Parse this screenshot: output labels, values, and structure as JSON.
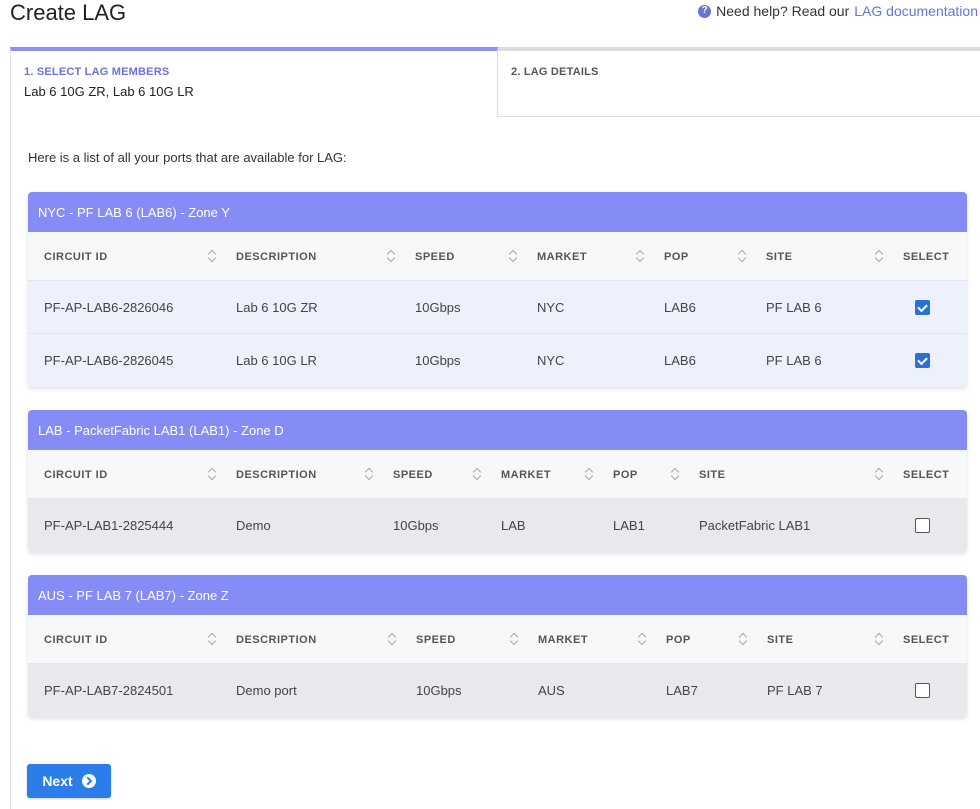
{
  "header": {
    "title": "Create LAG",
    "help_text": "Need help? Read our",
    "help_link": "LAG documentation",
    "help_icon": "question-circle-icon"
  },
  "steps": [
    {
      "label": "1. SELECT LAG MEMBERS",
      "value": "Lab 6 10G ZR, Lab 6 10G LR",
      "active": true
    },
    {
      "label": "2. LAG DETAILS",
      "value": "",
      "active": false
    }
  ],
  "intro": "Here is a list of all your ports that are available for LAG:",
  "groups": [
    {
      "title": "NYC - PF LAB 6 (LAB6) - Zone Y",
      "columns": [
        "CIRCUIT ID",
        "DESCRIPTION",
        "SPEED",
        "MARKET",
        "POP",
        "SITE",
        "SELECT"
      ],
      "rows": [
        {
          "circuit_id": "PF-AP-LAB6-2826046",
          "description": "Lab 6 10G ZR",
          "speed": "10Gbps",
          "market": "NYC",
          "pop": "LAB6",
          "site": "PF LAB 6",
          "selected": true
        },
        {
          "circuit_id": "PF-AP-LAB6-2826045",
          "description": "Lab 6 10G LR",
          "speed": "10Gbps",
          "market": "NYC",
          "pop": "LAB6",
          "site": "PF LAB 6",
          "selected": true
        }
      ]
    },
    {
      "title": "LAB - PacketFabric LAB1 (LAB1) - Zone D",
      "columns": [
        "CIRCUIT ID",
        "DESCRIPTION",
        "SPEED",
        "MARKET",
        "POP",
        "SITE",
        "SELECT"
      ],
      "rows": [
        {
          "circuit_id": "PF-AP-LAB1-2825444",
          "description": "Demo",
          "speed": "10Gbps",
          "market": "LAB",
          "pop": "LAB1",
          "site": "PacketFabric LAB1",
          "selected": false
        }
      ]
    },
    {
      "title": "AUS - PF LAB 7 (LAB7) - Zone Z",
      "columns": [
        "CIRCUIT ID",
        "DESCRIPTION",
        "SPEED",
        "MARKET",
        "POP",
        "SITE",
        "SELECT"
      ],
      "rows": [
        {
          "circuit_id": "PF-AP-LAB7-2824501",
          "description": "Demo port",
          "speed": "10Gbps",
          "market": "AUS",
          "pop": "LAB7",
          "site": "PF LAB 7",
          "selected": false
        }
      ]
    }
  ],
  "actions": {
    "next_label": "Next",
    "next_icon": "arrow-right-circle-icon"
  },
  "colors": {
    "accent": "#868cf5",
    "primary_button": "#2b7de9",
    "checkbox": "#2b6fd8"
  }
}
